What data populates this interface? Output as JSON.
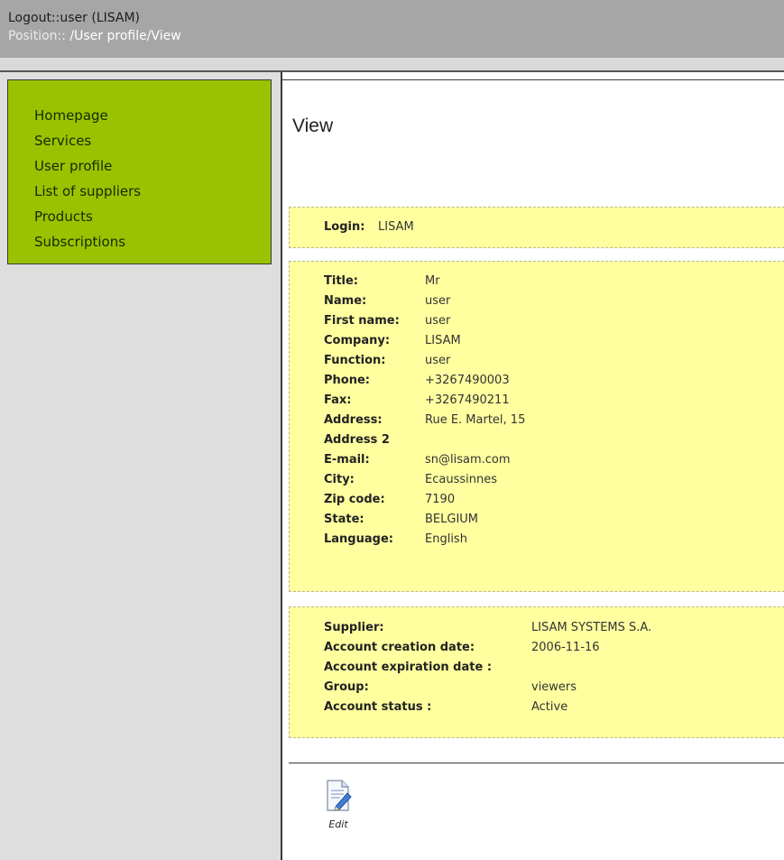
{
  "header": {
    "logout_link": "Logout::user (LISAM)",
    "position_label": "Position::",
    "position_path": " /User profile/View"
  },
  "sidebar": {
    "items": [
      {
        "label": "Homepage"
      },
      {
        "label": "Services"
      },
      {
        "label": "User profile"
      },
      {
        "label": "List of suppliers"
      },
      {
        "label": "Products"
      },
      {
        "label": "Subscriptions"
      }
    ]
  },
  "main": {
    "title": "View",
    "login": {
      "label": "Login:",
      "value": "LISAM"
    },
    "details": [
      {
        "label": "Title:",
        "value": "Mr"
      },
      {
        "label": "Name:",
        "value": "user"
      },
      {
        "label": "First name:",
        "value": "user"
      },
      {
        "label": "Company:",
        "value": "LISAM"
      },
      {
        "label": "Function:",
        "value": "user"
      },
      {
        "label": "Phone:",
        "value": "+3267490003"
      },
      {
        "label": "Fax:",
        "value": "+3267490211"
      },
      {
        "label": "Address:",
        "value": "Rue E. Martel, 15"
      },
      {
        "label": "Address 2",
        "value": ""
      },
      {
        "label": "E-mail:",
        "value": "sn@lisam.com"
      },
      {
        "label": "City:",
        "value": "Ecaussinnes"
      },
      {
        "label": "Zip code:",
        "value": "7190"
      },
      {
        "label": "State:",
        "value": "BELGIUM"
      },
      {
        "label": "Language:",
        "value": "English"
      }
    ],
    "account": [
      {
        "label": "Supplier:",
        "value": "LISAM SYSTEMS S.A."
      },
      {
        "label": "Account creation date:",
        "value": "2006-11-16"
      },
      {
        "label": "Account expiration date :",
        "value": ""
      },
      {
        "label": "Group:",
        "value": "viewers"
      },
      {
        "label": "Account status :",
        "value": "Active"
      }
    ],
    "edit_label": "Edit"
  },
  "colors": {
    "header_bg": "#a6a6a6",
    "nav_bg": "#9bc200",
    "panel_bg": "#ffffa0",
    "sidebar_bg": "#dedede"
  },
  "icons": {
    "edit": "edit-document-icon"
  }
}
